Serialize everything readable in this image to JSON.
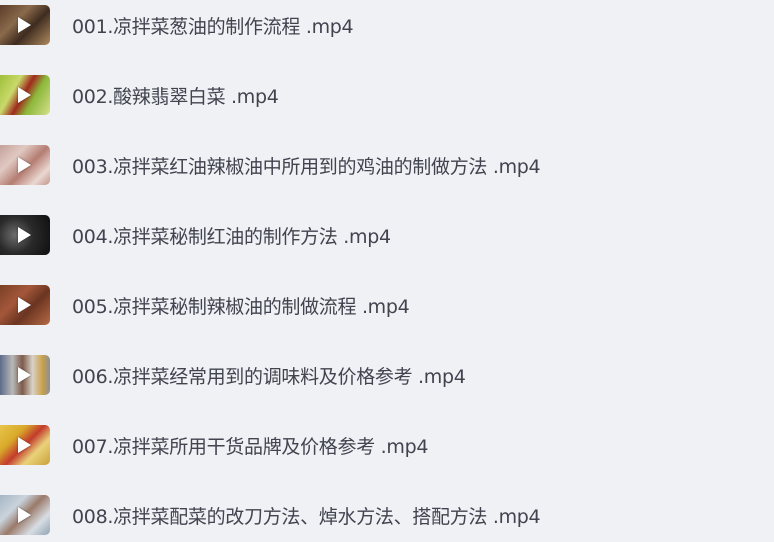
{
  "files": [
    {
      "name": "001.凉拌菜葱油的制作流程 .mp4",
      "icon": "play-icon"
    },
    {
      "name": "002.酸辣翡翠白菜 .mp4",
      "icon": "play-icon"
    },
    {
      "name": "003.凉拌菜红油辣椒油中所用到的鸡油的制做方法 .mp4",
      "icon": "play-icon"
    },
    {
      "name": "004.凉拌菜秘制红油的制作方法 .mp4",
      "icon": "play-icon"
    },
    {
      "name": "005.凉拌菜秘制辣椒油的制做流程 .mp4",
      "icon": "play-icon"
    },
    {
      "name": "006.凉拌菜经常用到的调味料及价格参考 .mp4",
      "icon": "play-icon"
    },
    {
      "name": "007.凉拌菜所用干货品牌及价格参考 .mp4",
      "icon": "play-icon"
    },
    {
      "name": "008.凉拌菜配菜的改刀方法、焯水方法、搭配方法 .mp4",
      "icon": "play-icon"
    }
  ],
  "colors": {
    "background": "#f0f1f5",
    "text": "#41444f",
    "play_icon": "#ffffff"
  }
}
